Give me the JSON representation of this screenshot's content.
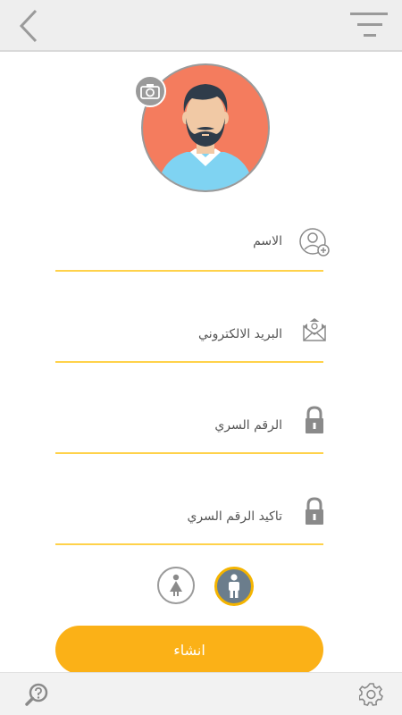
{
  "header": {
    "back_icon": "chevron-left-icon",
    "filter_icon": "filter-icon"
  },
  "profile": {
    "avatar_icon": "user-avatar",
    "camera_icon": "camera-icon"
  },
  "form": {
    "fields": [
      {
        "label": "الاسم",
        "icon": "add-user-icon"
      },
      {
        "label": "البريد الالكتروني",
        "icon": "email-icon"
      },
      {
        "label": "الرقم السري",
        "icon": "lock-icon"
      },
      {
        "label": "تاكيد الرقم السري",
        "icon": "lock-icon"
      }
    ],
    "gender": {
      "options": [
        "female",
        "male"
      ],
      "selected": "male"
    },
    "submit_label": "انشاء"
  },
  "footer": {
    "help_icon": "help-search-icon",
    "settings_icon": "gear-icon"
  },
  "colors": {
    "accent": "#fbb117",
    "underline": "#ffd24a",
    "avatar_bg": "#f47c5e",
    "header_bg": "#eeeeee"
  }
}
